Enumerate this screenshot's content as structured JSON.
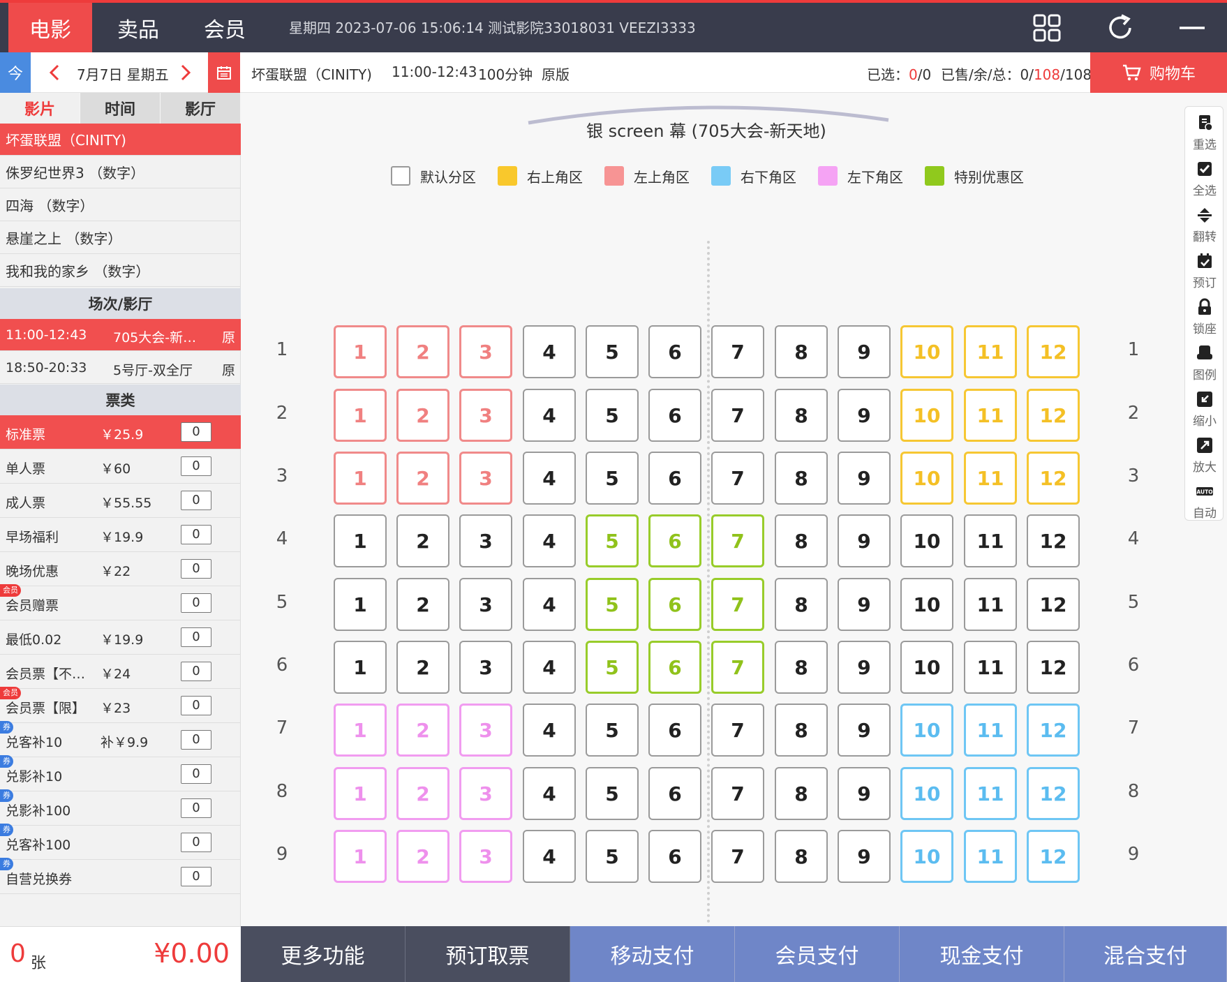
{
  "topbar": {
    "tabs": [
      {
        "label": "电影",
        "active": true
      },
      {
        "label": "卖品",
        "active": false
      },
      {
        "label": "会员",
        "active": false
      }
    ],
    "info": "星期四 2023-07-06 15:06:14 测试影院33018031 VEEZI3333",
    "icons": [
      "grid-icon",
      "refresh-icon",
      "minimize-icon"
    ]
  },
  "datebar": {
    "today_label": "今",
    "date": "7月7日 星期五",
    "prev": "<",
    "next": ">"
  },
  "showinfo": {
    "movie": "坏蛋联盟（CINITY)",
    "time": "11:00-12:43",
    "duration": "100分钟",
    "version": "原版",
    "selected_label": "已选：",
    "selected_value": "0",
    "selected_total": "/0",
    "sold_label": "已售/余/总：",
    "sold_value": "0/",
    "remain_value": "108",
    "total_value": "/108",
    "cart_label": "购物车"
  },
  "sidebar": {
    "tabs": [
      {
        "label": "影片",
        "active": true
      },
      {
        "label": "时间",
        "active": false
      },
      {
        "label": "影厅",
        "active": false
      }
    ],
    "movies": [
      {
        "label": "坏蛋联盟（CINITY)",
        "active": true
      },
      {
        "label": "侏罗纪世界3 （数字）",
        "active": false
      },
      {
        "label": "四海 （数字）",
        "active": false
      },
      {
        "label": "悬崖之上 （数字）",
        "active": false
      },
      {
        "label": "我和我的家乡 （数字）",
        "active": false
      }
    ],
    "sessions_header": "场次/影厅",
    "sessions": [
      {
        "time": "11:00-12:43",
        "hall": "705大会-新…",
        "version": "原",
        "active": true
      },
      {
        "time": "18:50-20:33",
        "hall": "5号厅-双全厅",
        "version": "原",
        "active": false
      }
    ],
    "tickets_header": "票类",
    "tickets": [
      {
        "name": "标准票",
        "price": "￥25.9",
        "qty": "0",
        "badge": "",
        "active": true
      },
      {
        "name": "单人票",
        "price": "￥60",
        "qty": "0",
        "badge": "",
        "active": false
      },
      {
        "name": "成人票",
        "price": "￥55.55",
        "qty": "0",
        "badge": "",
        "active": false
      },
      {
        "name": "早场福利",
        "price": "￥19.9",
        "qty": "0",
        "badge": "",
        "active": false
      },
      {
        "name": "晚场优惠",
        "price": "￥22",
        "qty": "0",
        "badge": "",
        "active": false
      },
      {
        "name": "会员赠票",
        "price": "",
        "qty": "0",
        "badge": "会员",
        "active": false
      },
      {
        "name": "最低0.02",
        "price": "￥19.9",
        "qty": "0",
        "badge": "",
        "active": false
      },
      {
        "name": "会员票【不…",
        "price": "￥24",
        "qty": "0",
        "badge": "",
        "active": false
      },
      {
        "name": "会员票【限】",
        "price": "￥23",
        "qty": "0",
        "badge": "会员",
        "active": false
      },
      {
        "name": "兑客补10",
        "price": "补￥9.9",
        "qty": "0",
        "badge": "券",
        "active": false
      },
      {
        "name": "兑影补10",
        "price": "",
        "qty": "0",
        "badge": "券",
        "active": false
      },
      {
        "name": "兑影补100",
        "price": "",
        "qty": "0",
        "badge": "券",
        "active": false
      },
      {
        "name": "兑客补100",
        "price": "",
        "qty": "0",
        "badge": "券",
        "active": false
      },
      {
        "name": "自营兑换券",
        "price": "",
        "qty": "0",
        "badge": "券",
        "active": false
      }
    ]
  },
  "summary": {
    "count": "0",
    "count_unit": "张",
    "total": "¥0.00"
  },
  "actions": [
    {
      "label": "更多功能",
      "style": "dark"
    },
    {
      "label": "预订取票",
      "style": "dark"
    },
    {
      "label": "移动支付",
      "style": "blue"
    },
    {
      "label": "会员支付",
      "style": "blue"
    },
    {
      "label": "现金支付",
      "style": "blue"
    },
    {
      "label": "混合支付",
      "style": "blue"
    }
  ],
  "screen": {
    "label": "银 screen 幕 (705大会-新天地)"
  },
  "legend": [
    {
      "label": "默认分区",
      "color": "#ffffff"
    },
    {
      "label": "右上角区",
      "color": "#f9c82c"
    },
    {
      "label": "左上角区",
      "color": "#f79494"
    },
    {
      "label": "右下角区",
      "color": "#79cbf6"
    },
    {
      "label": "左下角区",
      "color": "#f5a3f4"
    },
    {
      "label": "特别优惠区",
      "color": "#90c91d"
    }
  ],
  "seatmap": {
    "rows": [
      "1",
      "2",
      "3",
      "4",
      "5",
      "6",
      "7",
      "8",
      "9"
    ],
    "cols": [
      "1",
      "2",
      "3",
      "4",
      "5",
      "6",
      "7",
      "8",
      "9",
      "10",
      "11",
      "12"
    ],
    "zones": [
      [
        "tl",
        "tl",
        "tl",
        "",
        "",
        "",
        "",
        "",
        "",
        "tr",
        "tr",
        "tr"
      ],
      [
        "tl",
        "tl",
        "tl",
        "",
        "",
        "",
        "",
        "",
        "",
        "tr",
        "tr",
        "tr"
      ],
      [
        "tl",
        "tl",
        "tl",
        "",
        "",
        "",
        "",
        "",
        "",
        "tr",
        "tr",
        "tr"
      ],
      [
        "",
        "",
        "",
        "",
        "sp",
        "sp",
        "sp",
        "",
        "",
        "",
        "",
        ""
      ],
      [
        "",
        "",
        "",
        "",
        "sp",
        "sp",
        "sp",
        "",
        "",
        "",
        "",
        ""
      ],
      [
        "",
        "",
        "",
        "",
        "sp",
        "sp",
        "sp",
        "",
        "",
        "",
        "",
        ""
      ],
      [
        "bl",
        "bl",
        "bl",
        "",
        "",
        "",
        "",
        "",
        "",
        "br",
        "br",
        "br"
      ],
      [
        "bl",
        "bl",
        "bl",
        "",
        "",
        "",
        "",
        "",
        "",
        "br",
        "br",
        "br"
      ],
      [
        "bl",
        "bl",
        "bl",
        "",
        "",
        "",
        "",
        "",
        "",
        "br",
        "br",
        "br"
      ]
    ]
  },
  "tools": [
    {
      "label": "重选",
      "icon": "reselect-icon"
    },
    {
      "label": "全选",
      "icon": "select-all-icon"
    },
    {
      "label": "翻转",
      "icon": "flip-icon"
    },
    {
      "label": "预订",
      "icon": "calendar-check-icon"
    },
    {
      "label": "锁座",
      "icon": "lock-icon"
    },
    {
      "label": "图例",
      "icon": "legend-seat-icon"
    },
    {
      "label": "缩小",
      "icon": "zoom-out-icon"
    },
    {
      "label": "放大",
      "icon": "zoom-in-icon"
    },
    {
      "label": "自动",
      "icon": "auto-icon",
      "badge": "AUTO"
    }
  ]
}
